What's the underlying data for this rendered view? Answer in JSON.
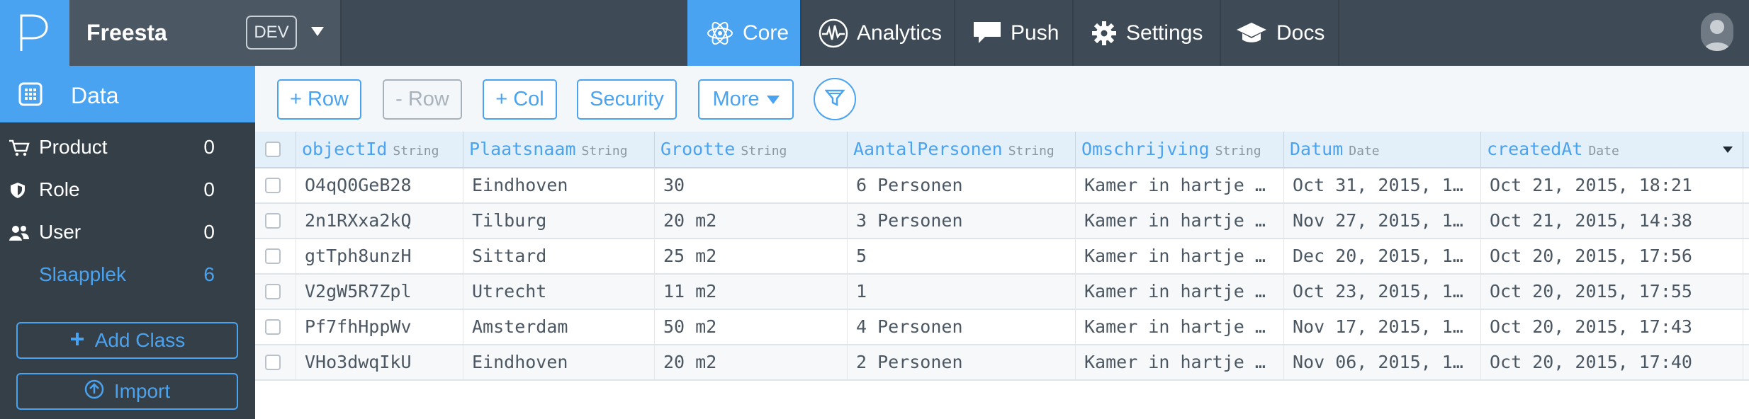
{
  "app": {
    "name": "Freesta",
    "env": "DEV"
  },
  "nav": {
    "core": "Core",
    "analytics": "Analytics",
    "push": "Push",
    "settings": "Settings",
    "docs": "Docs"
  },
  "sidebar": {
    "header": "Data",
    "classes": [
      {
        "name": "Product",
        "count": "0",
        "icon": "cart-icon"
      },
      {
        "name": "Role",
        "count": "0",
        "icon": "shield-icon"
      },
      {
        "name": "User",
        "count": "0",
        "icon": "users-icon"
      },
      {
        "name": "Slaapplek",
        "count": "6",
        "icon": ""
      }
    ],
    "add_class": "Add Class",
    "import": "Import"
  },
  "toolbar": {
    "add_row": "+ Row",
    "remove_row": "- Row",
    "add_col": "+ Col",
    "security": "Security",
    "more": "More"
  },
  "table": {
    "columns": [
      {
        "name": "objectId",
        "type": "String"
      },
      {
        "name": "Plaatsnaam",
        "type": "String"
      },
      {
        "name": "Grootte",
        "type": "String"
      },
      {
        "name": "AantalPersonen",
        "type": "String"
      },
      {
        "name": "Omschrijving",
        "type": "String"
      },
      {
        "name": "Datum",
        "type": "Date"
      },
      {
        "name": "createdAt",
        "type": "Date"
      }
    ],
    "rows": [
      [
        "O4qQ0GeB28",
        "Eindhoven",
        "30",
        "6 Personen",
        "Kamer in hartje …",
        "Oct 31, 2015, 1…",
        "Oct 21, 2015, 18:21"
      ],
      [
        "2n1RXxa2kQ",
        "Tilburg",
        "20 m2",
        "3 Personen",
        "Kamer in hartje …",
        "Nov 27, 2015, 1…",
        "Oct 21, 2015, 14:38"
      ],
      [
        "gtTph8unzH",
        "Sittard",
        "25 m2",
        "5",
        "Kamer in hartje …",
        "Dec 20, 2015, 1…",
        "Oct 20, 2015, 17:56"
      ],
      [
        "V2gW5R7Zpl",
        "Utrecht",
        "11 m2",
        "1",
        "Kamer in hartje …",
        "Oct 23, 2015, 1…",
        "Oct 20, 2015, 17:55"
      ],
      [
        "Pf7fhHppWv",
        "Amsterdam",
        "50 m2",
        "4 Personen",
        "Kamer in hartje …",
        "Nov 17, 2015, 1…",
        "Oct 20, 2015, 17:43"
      ],
      [
        "VHo3dwqIkU",
        "Eindhoven",
        "20 m2",
        "2 Personen",
        "Kamer in hartje …",
        "Nov 06, 2015, 1…",
        "Oct 20, 2015, 17:40"
      ]
    ]
  },
  "colors": {
    "accent": "#4aa3f0",
    "topbar": "#3e4a55",
    "sidebar": "#353f48"
  }
}
